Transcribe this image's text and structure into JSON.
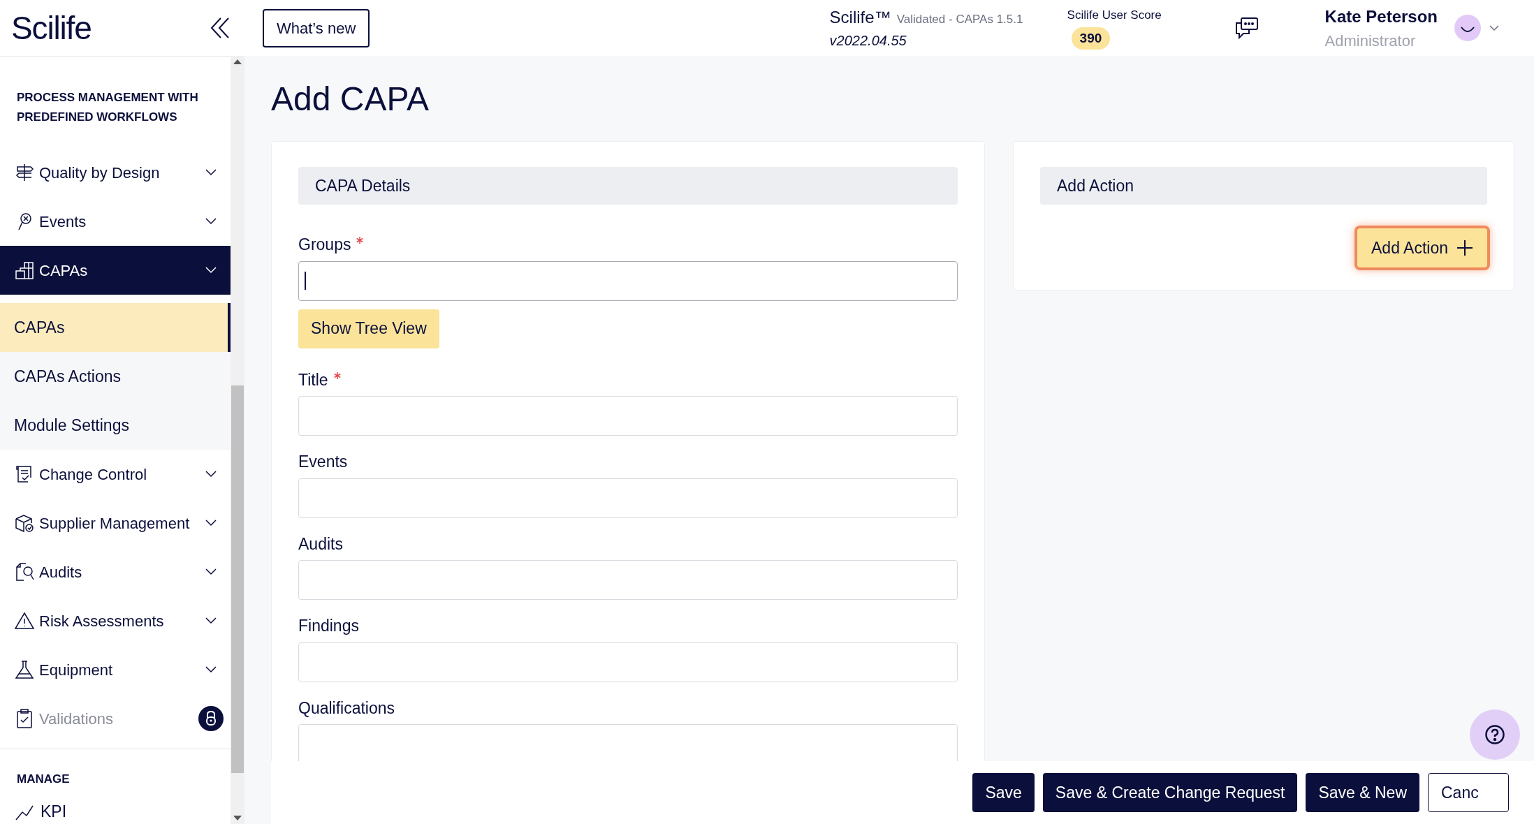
{
  "brand": "Scilife",
  "header": {
    "whats_new": "What’s new",
    "product": "Scilife™",
    "validated": "Validated - CAPAs 1.5.1",
    "version": "v2022.04.55",
    "score_label": "Scilife User Score",
    "score": "390",
    "user_name": "Kate Peterson",
    "user_role": "Administrator"
  },
  "sidebar": {
    "section": "PROCESS MANAGEMENT WITH PREDEFINED WORKFLOWS",
    "items": [
      {
        "label": "Quality by Design",
        "expanded": false,
        "locked": false
      },
      {
        "label": "Events",
        "expanded": false,
        "locked": false
      },
      {
        "label": "CAPAs",
        "expanded": true,
        "locked": false,
        "children": [
          {
            "label": "CAPAs",
            "selected": true
          },
          {
            "label": "CAPAs Actions",
            "selected": false
          },
          {
            "label": "Module Settings",
            "selected": false
          }
        ]
      },
      {
        "label": "Change Control",
        "expanded": false,
        "locked": false
      },
      {
        "label": "Supplier Management",
        "expanded": false,
        "locked": false
      },
      {
        "label": "Audits",
        "expanded": false,
        "locked": false
      },
      {
        "label": "Risk Assessments",
        "expanded": false,
        "locked": false
      },
      {
        "label": "Equipment",
        "expanded": false,
        "locked": false
      },
      {
        "label": "Validations",
        "expanded": false,
        "locked": true
      }
    ],
    "section_2": "MANAGE",
    "items_2": [
      {
        "label": "KPI"
      }
    ]
  },
  "page_title": "Add CAPA",
  "details": {
    "title": "CAPA Details",
    "tree_button": "Show Tree View",
    "fields": [
      {
        "label": "Groups",
        "required": true,
        "focused": true
      },
      {
        "label": "Title",
        "required": true,
        "focused": false
      },
      {
        "label": "Events",
        "required": false,
        "focused": false
      },
      {
        "label": "Audits",
        "required": false,
        "focused": false
      },
      {
        "label": "Findings",
        "required": false,
        "focused": false
      },
      {
        "label": "Qualifications",
        "required": false,
        "focused": false
      }
    ]
  },
  "actions": {
    "title": "Add Action",
    "button": "Add Action",
    "highlighted": true
  },
  "footer_buttons": [
    {
      "label": "Save",
      "kind": "primary"
    },
    {
      "label": "Save & Create Change Request",
      "kind": "primary"
    },
    {
      "label": "Save & New",
      "kind": "primary"
    },
    {
      "label": "Canc",
      "kind": "outline"
    }
  ]
}
